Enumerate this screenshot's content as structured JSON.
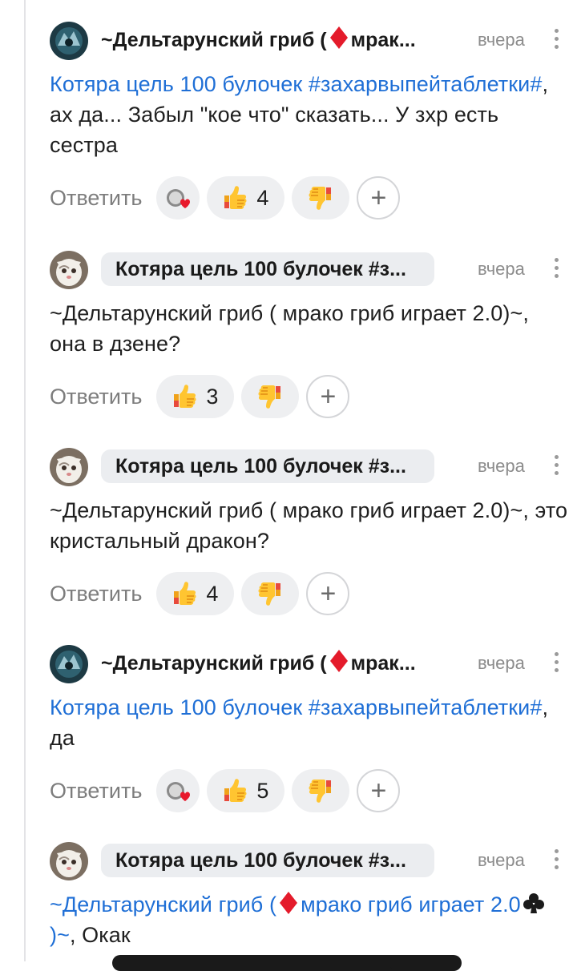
{
  "comments": [
    {
      "author": "~Дельтарунский гриб (",
      "author_tail": "мрак...",
      "author_has_diamond": true,
      "time": "вчера",
      "mention": "Котяра цель 100 булочек #захарвыпейтаблетки#",
      "text": ", ах да... Забыл \"кое что\" сказать... У зхр есть сестра",
      "reply": "Ответить",
      "likes": "4",
      "has_heart": true
    },
    {
      "author": "Котяра цель 100 булочек #з...",
      "time": "вчера",
      "text": "~Дельтарунский гриб ( мрако гриб играет 2.0)~, она в дзене?",
      "reply": "Ответить",
      "likes": "3",
      "has_heart": false
    },
    {
      "author": "Котяра цель 100 булочек #з...",
      "time": "вчера",
      "text": "~Дельтарунский гриб ( мрако гриб играет 2.0)~, это кристальный дракон?",
      "reply": "Ответить",
      "likes": "4",
      "has_heart": false
    },
    {
      "author": "~Дельтарунский гриб (",
      "author_tail": "мрак...",
      "author_has_diamond": true,
      "time": "вчера",
      "mention": "Котяра цель 100 булочек #захарвыпейтаблетки#",
      "text": ", да",
      "reply": "Ответить",
      "likes": "5",
      "has_heart": true
    },
    {
      "author": "Котяра цель 100 булочек #з...",
      "time": "вчера",
      "mention_a": "~Дельтарунский гриб (",
      "mention_b": "мрако гриб играет 2.0",
      "mention_c": ")~",
      "text": ", Окак"
    }
  ],
  "icons": {
    "like": "thumbs-up-icon",
    "dislike": "thumbs-down-icon",
    "add_reaction": "plus-icon",
    "more": "more-vertical-icon",
    "diamond": "red-diamond-icon",
    "club": "club-icon"
  },
  "colors": {
    "mention": "#1f6fd6",
    "pill": "#ebedf0",
    "chip": "#eeeff1",
    "muted": "#8c8c8c"
  }
}
